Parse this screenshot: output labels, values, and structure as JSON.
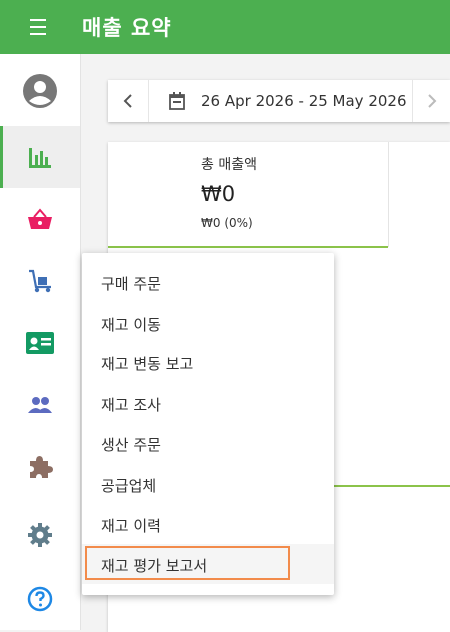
{
  "header": {
    "title": "매출 요약"
  },
  "icons": {
    "menu": "hamburger-menu-icon",
    "sidebar": [
      "account-circle-icon",
      "bar-chart-icon",
      "shopping-basket-icon",
      "warehouse-dolly-icon",
      "id-card-icon",
      "people-icon",
      "puzzle-icon",
      "gear-icon",
      "help-circle-icon"
    ]
  },
  "colors": {
    "brand": "#4caf50",
    "active_indicator": "#4caf50",
    "chart_line": "#8bc34a",
    "basket": "#e91e63",
    "dolly": "#3f6fb5",
    "idcard": "#139a63",
    "people": "#5c6bc0",
    "puzzle": "#8d6e63",
    "gear": "#607d8b",
    "help": "#1e88e5",
    "highlight_box": "#f28b4b"
  },
  "date_range": {
    "label": "26 Apr 2026 - 25 May 2026"
  },
  "metric": {
    "label": "총 매출액",
    "value": "₩0",
    "change": "₩0 (0%)"
  },
  "dropdown": {
    "items": [
      {
        "label": "구매 주문"
      },
      {
        "label": "재고 이동"
      },
      {
        "label": "재고 변동 보고"
      },
      {
        "label": "재고 조사"
      },
      {
        "label": "생산 주문"
      },
      {
        "label": "공급업체"
      },
      {
        "label": "재고 이력"
      },
      {
        "label": "재고 평가 보고서"
      }
    ],
    "highlighted_index": 7
  },
  "chart_data": {
    "type": "line",
    "series": [
      {
        "values": [
          0,
          0,
          0,
          0,
          0
        ]
      }
    ]
  }
}
